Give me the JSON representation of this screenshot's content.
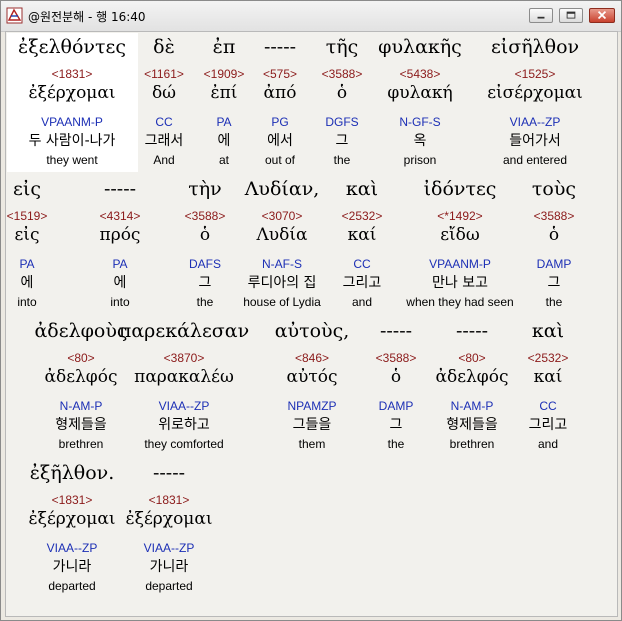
{
  "window": {
    "title": "@원전분해 - 행 16:40"
  },
  "colors": {
    "strongs": "#8b1a1a",
    "parse": "#1c2fb5",
    "highlight": "#ffffff"
  },
  "words": [
    {
      "word": "ἐξελθόντες",
      "strongs": "<1831>",
      "lemma": "ἐξέρχομαι",
      "parse": "VPAANM-P",
      "korean": "두 사람이-나가",
      "english": "they went"
    },
    {
      "word": "δὲ",
      "strongs": "<1161>",
      "lemma": "δώ",
      "parse": "CC",
      "korean": "그래서",
      "english": "And"
    },
    {
      "word": "ἐπ",
      "strongs": "<1909>",
      "lemma": "ἐπί",
      "parse": "PA",
      "korean": "에",
      "english": "at"
    },
    {
      "word": "-----",
      "strongs": "<575>",
      "lemma": "ἀπό",
      "parse": "PG",
      "korean": "에서",
      "english": "out of"
    },
    {
      "word": "τῆς",
      "strongs": "<3588>",
      "lemma": "ὁ",
      "parse": "DGFS",
      "korean": "그",
      "english": "the"
    },
    {
      "word": "φυλακῆς",
      "strongs": "<5438>",
      "lemma": "φυλακή",
      "parse": "N-GF-S",
      "korean": "옥",
      "english": "prison"
    },
    {
      "word": "εἰσῆλθον",
      "strongs": "<1525>",
      "lemma": "εἰσέρχομαι",
      "parse": "VIAA--ZP",
      "korean": "들어가서",
      "english": "and entered"
    },
    {
      "word": "εἰς",
      "strongs": "<1519>",
      "lemma": "εἰς",
      "parse": "PA",
      "korean": "에",
      "english": "into"
    },
    {
      "word": "-----",
      "strongs": "<4314>",
      "lemma": "πρός",
      "parse": "PA",
      "korean": "에",
      "english": "into"
    },
    {
      "word": "τὴν",
      "strongs": "<3588>",
      "lemma": "ὁ",
      "parse": "DAFS",
      "korean": "그",
      "english": "the"
    },
    {
      "word": "Λυδίαν,",
      "strongs": "<3070>",
      "lemma": "Λυδία",
      "parse": "N-AF-S",
      "korean": "루디아의 집",
      "english": "house of Lydia"
    },
    {
      "word": "καὶ",
      "strongs": "<2532>",
      "lemma": "καί",
      "parse": "CC",
      "korean": "그리고",
      "english": "and"
    },
    {
      "word": "ἰδόντες",
      "strongs": "<*1492>",
      "lemma": "εἴδω",
      "parse": "VPAANM-P",
      "korean": "만나 보고",
      "english": "when they had seen"
    },
    {
      "word": "τοὺς",
      "strongs": "<3588>",
      "lemma": "ὁ",
      "parse": "DAMP",
      "korean": "그",
      "english": "the"
    },
    {
      "word": "ἀδελφοὺς",
      "strongs": "<80>",
      "lemma": "ἀδελφός",
      "parse": "N-AM-P",
      "korean": "형제들을",
      "english": "brethren"
    },
    {
      "word": "παρεκάλεσαν",
      "strongs": "<3870>",
      "lemma": "παρακαλέω",
      "parse": "VIAA--ZP",
      "korean": "위로하고",
      "english": "they comforted"
    },
    {
      "word": "αὐτοὺς,",
      "strongs": "<846>",
      "lemma": "αὐτός",
      "parse": "NPAMZP",
      "korean": "그들을",
      "english": "them"
    },
    {
      "word": "-----",
      "strongs": "<3588>",
      "lemma": "ὁ",
      "parse": "DAMP",
      "korean": "그",
      "english": "the"
    },
    {
      "word": "-----",
      "strongs": "<80>",
      "lemma": "ἀδελφός",
      "parse": "N-AM-P",
      "korean": "형제들을",
      "english": "brethren"
    },
    {
      "word": "καὶ",
      "strongs": "<2532>",
      "lemma": "καί",
      "parse": "CC",
      "korean": "그리고",
      "english": "and"
    },
    {
      "word": "ἐξῆλθον.",
      "strongs": "<1831>",
      "lemma": "ἐξέρχομαι",
      "parse": "VIAA--ZP",
      "korean": "가니라",
      "english": "departed"
    },
    {
      "word": "-----",
      "strongs": "<1831>",
      "lemma": "ἐξέρχομαι",
      "parse": "VIAA--ZP",
      "korean": "가니라",
      "english": "departed"
    }
  ]
}
